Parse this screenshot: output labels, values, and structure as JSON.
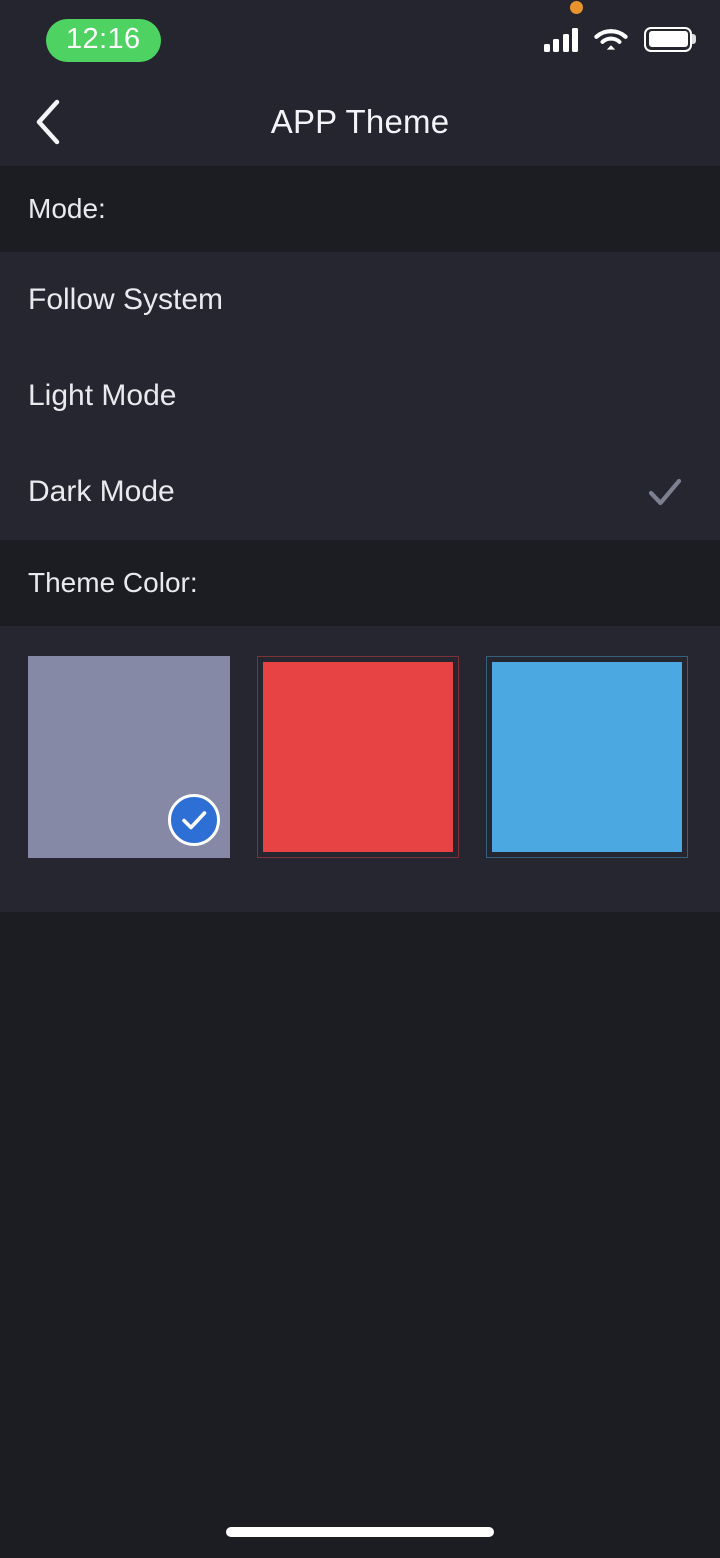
{
  "status_bar": {
    "time": "12:16",
    "time_pill_color": "#4ed362",
    "privacy_dot_color": "#e8942e",
    "signal_icon": "cellular-signal-icon",
    "signal_bars_filled": 4,
    "signal_bars_total": 4,
    "wifi_icon": "wifi-icon",
    "battery_icon": "battery-icon",
    "battery_level_percent": 100
  },
  "nav_bar": {
    "back_icon": "chevron-left-icon",
    "title": "APP Theme"
  },
  "mode_section": {
    "header": "Mode:",
    "options": [
      {
        "label": "Follow System",
        "selected": false
      },
      {
        "label": "Light Mode",
        "selected": false
      },
      {
        "label": "Dark Mode",
        "selected": true
      }
    ],
    "check_icon": "check-icon",
    "check_color": "#7c8091"
  },
  "theme_color_section": {
    "header": "Theme Color:",
    "swatches": [
      {
        "name": "gray",
        "color": "#8589a6",
        "selected": true,
        "outlined": false
      },
      {
        "name": "red",
        "color": "#e84344",
        "selected": false,
        "outlined": true
      },
      {
        "name": "blue",
        "color": "#4ca8e0",
        "selected": false,
        "outlined": true
      }
    ],
    "selected_badge_icon": "check-circle-icon",
    "selected_badge_color": "#2e6fd6"
  },
  "home_indicator": {
    "icon": "home-indicator-bar",
    "color": "#ffffff"
  },
  "theme": {
    "page_background": "#1c1d23",
    "panel_background": "#25262f",
    "nav_background": "#24252e",
    "text_primary": "#e9eaee"
  }
}
